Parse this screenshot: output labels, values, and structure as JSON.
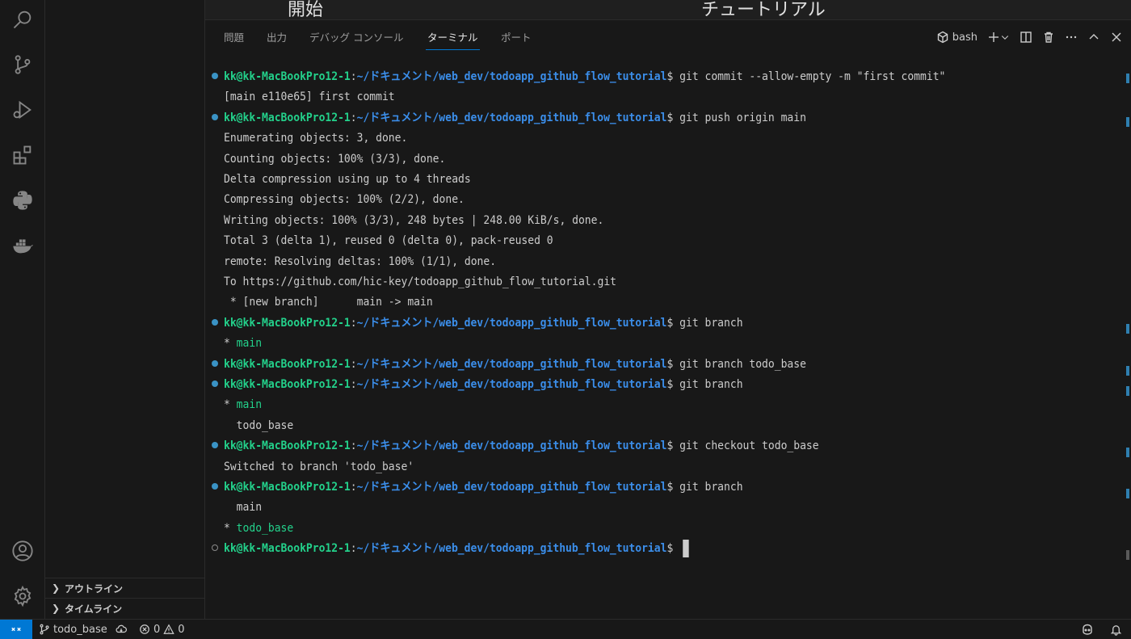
{
  "editor": {
    "tabs": [
      {
        "label": "開始"
      },
      {
        "label": "チュートリアル"
      }
    ]
  },
  "activity_bar": {
    "icons": [
      "search-icon",
      "source-control-icon",
      "run-debug-icon",
      "extensions-icon",
      "python-icon",
      "docker-icon",
      "account-icon",
      "settings-gear-icon"
    ]
  },
  "sidebar": {
    "sections": [
      {
        "label": "アウトライン"
      },
      {
        "label": "タイムライン"
      }
    ]
  },
  "panel": {
    "tabs": [
      {
        "label": "問題"
      },
      {
        "label": "出力"
      },
      {
        "label": "デバッグ コンソール"
      },
      {
        "label": "ターミナル",
        "active": true
      },
      {
        "label": "ポート"
      }
    ],
    "terminal_name": "bash"
  },
  "terminal": {
    "prompt_user": "kk@kk-MacBookPro12-1",
    "prompt_sep": ":",
    "prompt_path": "~/ドキュメント/web_dev/todoapp_github_flow_tutorial",
    "prompt_end": "$",
    "lines": [
      {
        "kind": "cmd",
        "marker": "done",
        "command": " git commit --allow-empty -m \"first commit\""
      },
      {
        "kind": "out",
        "text": "[main e110e65] first commit"
      },
      {
        "kind": "cmd",
        "marker": "done",
        "command": " git push origin main"
      },
      {
        "kind": "out",
        "text": "Enumerating objects: 3, done."
      },
      {
        "kind": "out",
        "text": "Counting objects: 100% (3/3), done."
      },
      {
        "kind": "out",
        "text": "Delta compression using up to 4 threads"
      },
      {
        "kind": "out",
        "text": "Compressing objects: 100% (2/2), done."
      },
      {
        "kind": "out",
        "text": "Writing objects: 100% (3/3), 248 bytes | 248.00 KiB/s, done."
      },
      {
        "kind": "out",
        "text": "Total 3 (delta 1), reused 0 (delta 0), pack-reused 0"
      },
      {
        "kind": "out",
        "text": "remote: Resolving deltas: 100% (1/1), done."
      },
      {
        "kind": "out",
        "text": "To https://github.com/hic-key/todoapp_github_flow_tutorial.git"
      },
      {
        "kind": "out",
        "text": " * [new branch]      main -> main"
      },
      {
        "kind": "cmd",
        "marker": "done",
        "command": " git branch"
      },
      {
        "kind": "branch",
        "star": "* ",
        "name": "main",
        "current": true
      },
      {
        "kind": "cmd",
        "marker": "done",
        "command": " git branch todo_base"
      },
      {
        "kind": "cmd",
        "marker": "done",
        "command": " git branch"
      },
      {
        "kind": "branch",
        "star": "* ",
        "name": "main",
        "current": true
      },
      {
        "kind": "branch",
        "star": "  ",
        "name": "todo_base",
        "current": false
      },
      {
        "kind": "cmd",
        "marker": "done",
        "command": " git checkout todo_base"
      },
      {
        "kind": "out",
        "text": "Switched to branch 'todo_base'"
      },
      {
        "kind": "cmd",
        "marker": "done",
        "command": " git branch"
      },
      {
        "kind": "branch",
        "star": "  ",
        "name": "main",
        "current": false
      },
      {
        "kind": "branch",
        "star": "* ",
        "name": "todo_base",
        "current": true
      },
      {
        "kind": "cmd",
        "marker": "pending",
        "command": " ",
        "cursor": true
      }
    ]
  },
  "statusbar": {
    "branch": "todo_base",
    "errors": "0",
    "warnings": "0"
  },
  "colors": {
    "accent": "#0078d4",
    "prompt_user": "#23d18b",
    "prompt_path": "#3b8eea",
    "background": "#181818"
  }
}
